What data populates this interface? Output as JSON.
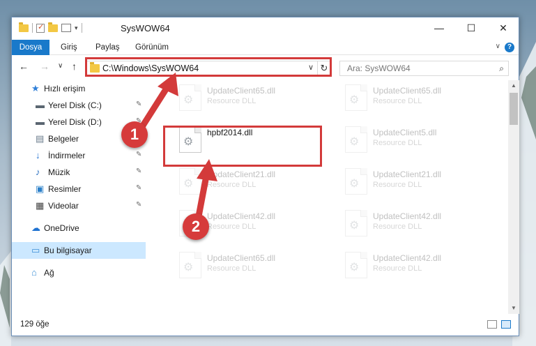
{
  "window": {
    "title": "SysWOW64",
    "min_glyph": "—",
    "max_glyph": "☐",
    "close_glyph": "✕"
  },
  "ribbon": {
    "tabs": [
      "Dosya",
      "Giriş",
      "Paylaş",
      "Görünüm"
    ],
    "expand_glyph": "∨",
    "help_glyph": "?"
  },
  "navbar": {
    "back_glyph": "←",
    "forward_glyph": "→",
    "history_glyph": "∨",
    "up_glyph": "↑",
    "path": "C:\\Windows\\SysWOW64",
    "dropdown_glyph": "∨",
    "refresh_glyph": "↻",
    "search_placeholder": "Ara: SysWOW64",
    "search_glyph": "⌕"
  },
  "sidebar": {
    "items": [
      {
        "label": "Hızlı erişim",
        "icon": "star-icon",
        "pinned": false
      },
      {
        "label": "Yerel Disk (C:)",
        "icon": "drive-icon",
        "pinned": true
      },
      {
        "label": "Yerel Disk (D:)",
        "icon": "drive-icon",
        "pinned": true
      },
      {
        "label": "Belgeler",
        "icon": "documents-icon",
        "pinned": true
      },
      {
        "label": "İndirmeler",
        "icon": "download-icon",
        "pinned": true
      },
      {
        "label": "Müzik",
        "icon": "music-icon",
        "pinned": true
      },
      {
        "label": "Resimler",
        "icon": "pictures-icon",
        "pinned": true
      },
      {
        "label": "Videolar",
        "icon": "videos-icon",
        "pinned": true
      },
      {
        "label": "OneDrive",
        "icon": "cloud-icon",
        "pinned": false
      },
      {
        "label": "Bu bilgisayar",
        "icon": "computer-icon",
        "pinned": false,
        "selected": true
      },
      {
        "label": "Ağ",
        "icon": "network-icon",
        "pinned": false
      }
    ],
    "pin_glyph": "📌"
  },
  "files": {
    "highlighted": {
      "name": "hpbf2014.dll"
    },
    "left_column": [
      {
        "name": "UpdateClient65.dll",
        "type": "Resource DLL"
      },
      {
        "name": "UpdateClient21.dll",
        "type": "Resource DLL"
      },
      {
        "name": "UpdateClient42.dll",
        "type": "Resource DLL"
      },
      {
        "name": "UpdateClient65.dll",
        "type": "Resource DLL"
      }
    ],
    "right_column": [
      {
        "name": "UpdateClient65.dll",
        "type": "Resource DLL"
      },
      {
        "name": "UpdateClient5.dll",
        "type": "Resource DLL"
      },
      {
        "name": "UpdateClient21.dll",
        "type": "Resource DLL"
      },
      {
        "name": "UpdateClient42.dll",
        "type": "Resource DLL"
      },
      {
        "name": "UpdateClient42.dll",
        "type": "Resource DLL"
      }
    ],
    "gear_glyph": "⚙"
  },
  "status": {
    "item_count": "129 öğe"
  },
  "annotations": {
    "step1": "1",
    "step2": "2",
    "color": "#d33a3a"
  },
  "colors": {
    "accent": "#1979ca",
    "selection": "#cce8ff"
  }
}
